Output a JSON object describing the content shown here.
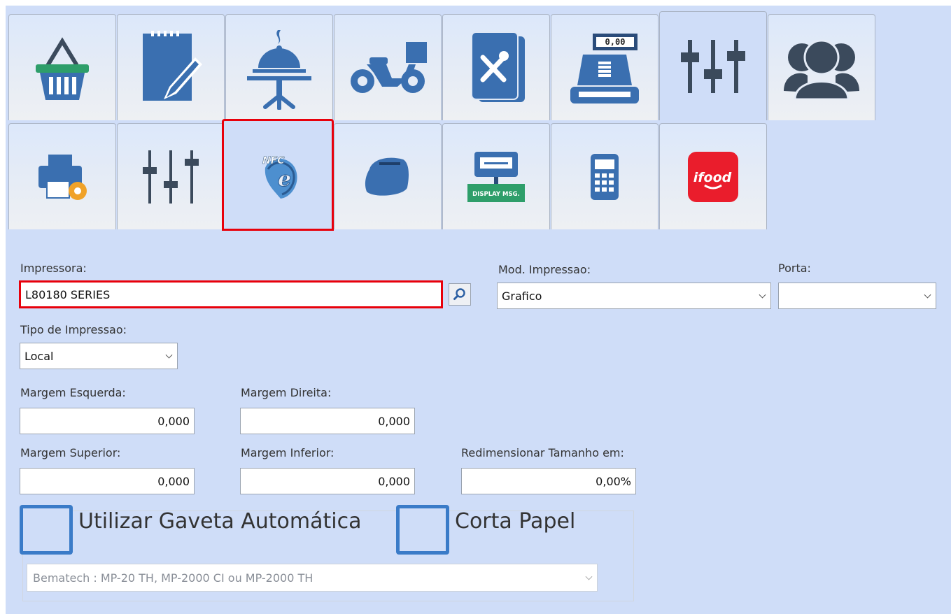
{
  "toolbar_row1": [
    {
      "name": "basket-icon"
    },
    {
      "name": "notepad-edit-icon"
    },
    {
      "name": "restaurant-table-icon"
    },
    {
      "name": "delivery-motorcycle-icon"
    },
    {
      "name": "menu-book-icon"
    },
    {
      "name": "cash-register-icon",
      "display": "0,00"
    },
    {
      "name": "settings-sliders-icon"
    },
    {
      "name": "users-icon"
    }
  ],
  "toolbar_row2": [
    {
      "name": "printer-settings-icon"
    },
    {
      "name": "sliders-icon"
    },
    {
      "name": "nfce-icon",
      "text": "NFC"
    },
    {
      "name": "receipt-printer-icon"
    },
    {
      "name": "display-message-icon",
      "text": "DISPLAY MSG."
    },
    {
      "name": "calculator-icon"
    },
    {
      "name": "ifood-icon",
      "text": "ifood"
    }
  ],
  "form": {
    "impressora_label": "Impressora:",
    "impressora_value": "L80180 SERIES",
    "mod_impressao_label": "Mod. Impressao:",
    "mod_impressao_value": "Grafico",
    "porta_label": "Porta:",
    "porta_value": "",
    "tipo_impressao_label": "Tipo de Impressao:",
    "tipo_impressao_value": "Local",
    "margem_esquerda_label": "Margem Esquerda:",
    "margem_esquerda_value": "0,000",
    "margem_direita_label": "Margem Direita:",
    "margem_direita_value": "0,000",
    "margem_superior_label": "Margem Superior:",
    "margem_superior_value": "0,000",
    "margem_inferior_label": "Margem Inferior:",
    "margem_inferior_value": "0,000",
    "redimensionar_label": "Redimensionar Tamanho em:",
    "redimensionar_value": "0,00%",
    "gaveta_label": "Utilizar Gaveta Automática",
    "corta_papel_label": "Corta Papel",
    "modelo_gaveta_value": "Bematech : MP-20 TH, MP-2000 CI ou MP-2000 TH"
  },
  "colors": {
    "panel_bg": "#cfddf8",
    "accent_blue": "#3a6fb0",
    "highlight_red": "#e8000b",
    "ifood_red": "#ea1d2c"
  }
}
